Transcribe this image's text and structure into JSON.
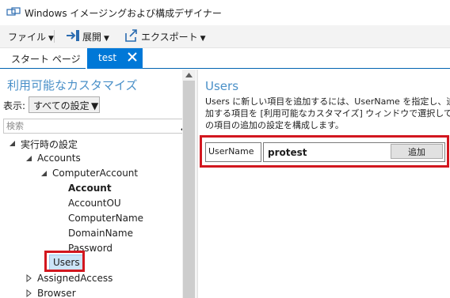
{
  "window": {
    "title": "Windows イメージングおよび構成デザイナー"
  },
  "menu": {
    "file_label": "ファイル",
    "deploy_label": "展開",
    "export_label": "エクスポート"
  },
  "tabs": {
    "start_label": "スタート ページ",
    "active_label": "test"
  },
  "left": {
    "title": "利用可能なカスタマイズ",
    "filter_label": "表示:",
    "filter_value": "すべての設定",
    "search_placeholder": "検索",
    "tree": [
      {
        "label": "実行時の設定",
        "expanded": true
      },
      {
        "label": "Accounts",
        "expanded": true
      },
      {
        "label": "ComputerAccount",
        "expanded": true
      },
      {
        "label": "Account",
        "bold": true
      },
      {
        "label": "AccountOU"
      },
      {
        "label": "ComputerName"
      },
      {
        "label": "DomainName"
      },
      {
        "label": "Password"
      },
      {
        "label": "Users",
        "selected": true
      },
      {
        "label": "AssignedAccess",
        "expanded": false
      },
      {
        "label": "Browser",
        "expanded": false
      }
    ]
  },
  "right": {
    "title": "Users",
    "description_lines": [
      "Users に新しい項目を追加するには、UserName を指定し、追",
      "加する項目を [利用可能なカスタマイズ] ウィンドウで選択して、こ",
      "の項目の追加の設定を構成します。"
    ],
    "field_label": "UserName",
    "field_value": "protest",
    "add_button": "追加"
  },
  "colors": {
    "accent": "#0078d7",
    "heading": "#4a90c8",
    "highlight_box": "#d2171f",
    "selected_bg": "#cce4f7"
  },
  "icons": [
    "app-icon",
    "deploy-icon",
    "export-icon",
    "close-icon",
    "search-icon",
    "expand-arrow-icon",
    "collapsed-arrow-icon"
  ]
}
